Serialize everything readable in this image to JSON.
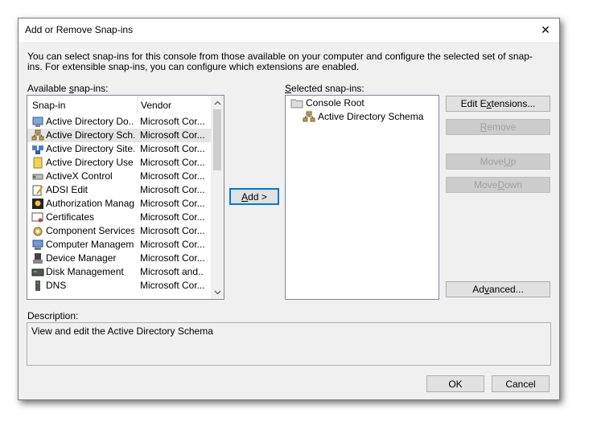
{
  "window": {
    "title": "Add or Remove Snap-ins",
    "close_symbol": "✕"
  },
  "intro": "You can select snap-ins for this console from those available on your computer and configure the selected set of snap-ins. For extensible snap-ins, you can configure which extensions are enabled.",
  "available": {
    "label_pre": "Available ",
    "label_key": "s",
    "label_post": "nap-ins:",
    "col_snapin": "Snap-in",
    "col_vendor": "Vendor",
    "items": [
      {
        "name": "Active Directory Do...",
        "vendor": "Microsoft Cor...",
        "icon": "ad-domains-icon"
      },
      {
        "name": "Active Directory Sch...",
        "vendor": "Microsoft Cor...",
        "icon": "ad-schema-icon",
        "selected": true
      },
      {
        "name": "Active Directory Site...",
        "vendor": "Microsoft Cor...",
        "icon": "ad-sites-icon"
      },
      {
        "name": "Active Directory Use...",
        "vendor": "Microsoft Cor...",
        "icon": "ad-users-icon"
      },
      {
        "name": "ActiveX Control",
        "vendor": "Microsoft Cor...",
        "icon": "activex-icon"
      },
      {
        "name": "ADSI Edit",
        "vendor": "Microsoft Cor...",
        "icon": "adsi-edit-icon"
      },
      {
        "name": "Authorization Manager",
        "vendor": "Microsoft Cor...",
        "icon": "authorization-icon"
      },
      {
        "name": "Certificates",
        "vendor": "Microsoft Cor...",
        "icon": "certificates-icon"
      },
      {
        "name": "Component Services",
        "vendor": "Microsoft Cor...",
        "icon": "component-services-icon"
      },
      {
        "name": "Computer Managem...",
        "vendor": "Microsoft Cor...",
        "icon": "computer-management-icon"
      },
      {
        "name": "Device Manager",
        "vendor": "Microsoft Cor...",
        "icon": "device-manager-icon"
      },
      {
        "name": "Disk Management",
        "vendor": "Microsoft and...",
        "icon": "disk-management-icon"
      },
      {
        "name": "DNS",
        "vendor": "Microsoft Cor...",
        "icon": "dns-icon"
      }
    ]
  },
  "add_button": {
    "key": "A",
    "rest": "dd >"
  },
  "selected": {
    "label_key": "S",
    "label_post": "elected snap-ins:",
    "root": "Console Root",
    "child": "Active Directory Schema"
  },
  "buttons": {
    "edit_ext": {
      "pre": "Edit E",
      "key": "x",
      "post": "tensions..."
    },
    "remove": {
      "pre": "",
      "key": "R",
      "post": "emove"
    },
    "move_up": {
      "pre": "Move ",
      "key": "U",
      "post": "p"
    },
    "move_down": {
      "pre": "Move ",
      "key": "D",
      "post": "own"
    },
    "advanced": {
      "pre": "Ad",
      "key": "v",
      "post": "anced..."
    },
    "ok": "OK",
    "cancel": "Cancel"
  },
  "description": {
    "label": "Description:",
    "text": "View and edit the Active Directory Schema"
  },
  "colors": {
    "selection": "#e5e5e5",
    "focus_border": "#0078d7",
    "dialog_bg": "#f0f0f0"
  }
}
